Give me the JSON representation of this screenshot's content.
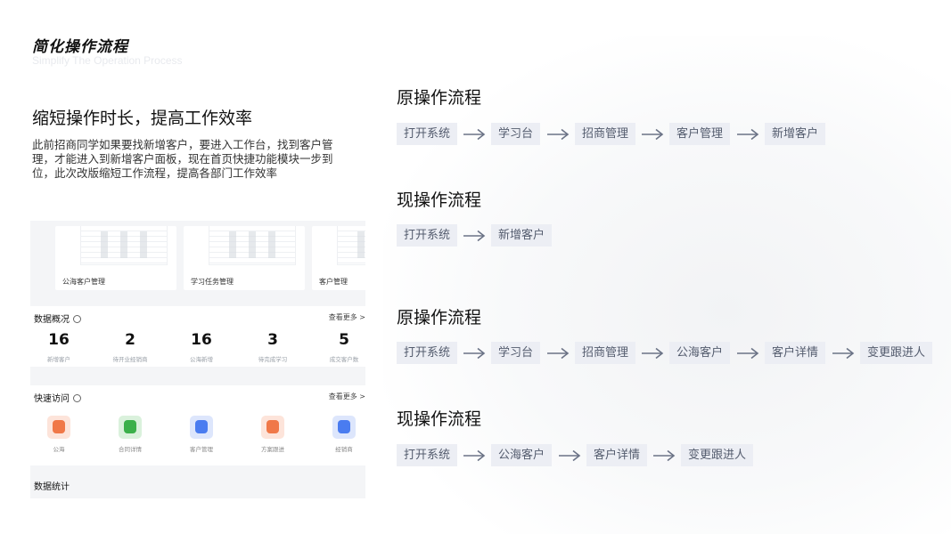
{
  "header": {
    "title": "简化操作流程",
    "subtitle": "Simplify The Operation Process"
  },
  "left": {
    "heading": "缩短操作时长，提高工作效率",
    "description": "此前招商同学如果要找新增客户，要进入工作台，找到客户管理，才能进入到新增客户面板，现在首页快捷功能模块一步到位，此次改版缩短工作流程，提高各部门工作效率"
  },
  "mockup": {
    "cards": [
      "公海客户管理",
      "学习任务管理",
      "客户管理"
    ],
    "overview": {
      "title": "数据概况",
      "more": "查看更多 >",
      "stats": [
        {
          "value": "16",
          "label": "新增客户"
        },
        {
          "value": "2",
          "label": "待开业经销商"
        },
        {
          "value": "16",
          "label": "公海新增"
        },
        {
          "value": "3",
          "label": "待完成学习"
        },
        {
          "value": "5",
          "label": "成交客户数"
        }
      ]
    },
    "quick": {
      "title": "快速访问",
      "more": "查看更多 >",
      "items": [
        {
          "label": "公海",
          "icon": "sea-customer-icon",
          "color": "#f07848"
        },
        {
          "label": "合同详情",
          "icon": "contract-icon",
          "color": "#3bb04a"
        },
        {
          "label": "客户管理",
          "icon": "customer-manage-icon",
          "color": "#4a7cf0"
        },
        {
          "label": "方案跟进",
          "icon": "plan-follow-icon",
          "color": "#f07848"
        },
        {
          "label": "经销商",
          "icon": "dealer-icon",
          "color": "#4a7cf0"
        }
      ]
    },
    "bottom_label": "数据统计"
  },
  "flows": [
    {
      "title": "原操作流程",
      "steps": [
        "打开系统",
        "学习台",
        "招商管理",
        "客户管理",
        "新增客户"
      ]
    },
    {
      "title": "现操作流程",
      "steps": [
        "打开系统",
        "新增客户"
      ]
    },
    {
      "title": "原操作流程",
      "steps": [
        "打开系统",
        "学习台",
        "招商管理",
        "公海客户",
        "客户详情",
        "变更跟进人"
      ]
    },
    {
      "title": "现操作流程",
      "steps": [
        "打开系统",
        "公海客户",
        "客户详情",
        "变更跟进人"
      ]
    }
  ],
  "colors": {
    "step_bg": "#eceef4",
    "step_text": "#545c6e",
    "arrow": "#6b7386"
  }
}
